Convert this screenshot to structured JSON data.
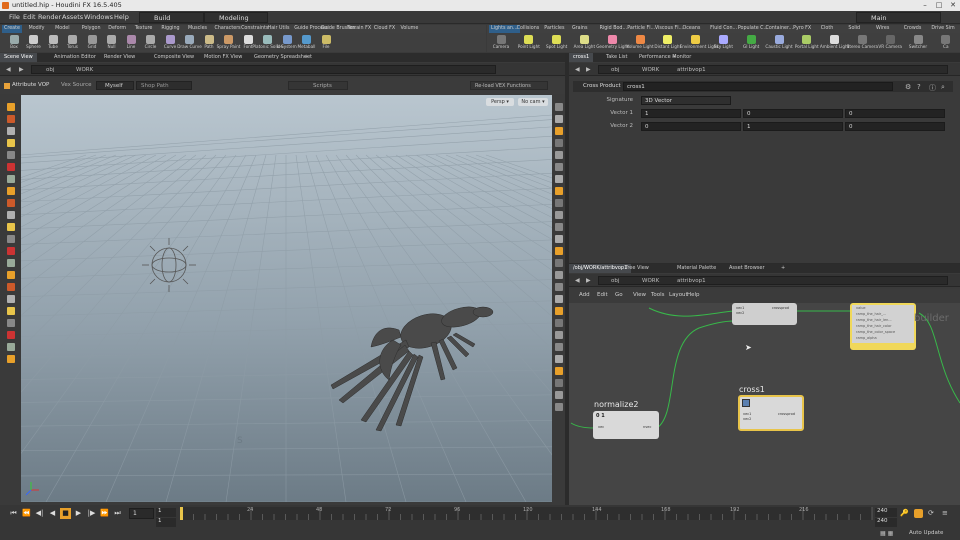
{
  "window": {
    "title": "untitled.hip - Houdini FX 16.5.405"
  },
  "menu": {
    "items": [
      "File",
      "Edit",
      "Render",
      "Assets",
      "Windows",
      "Help"
    ],
    "desktop": "Build",
    "context": "Modeling",
    "main_desktop": "Main"
  },
  "shelf_tabs_left": [
    "Create",
    "Modify",
    "Model",
    "Polygon",
    "Deform",
    "Texture",
    "Rigging",
    "Muscles",
    "Characters",
    "Constraints",
    "Hair Utils",
    "Guide Process",
    "Guide Brushes",
    "Terrain FX",
    "Cloud FX",
    "Volume"
  ],
  "shelf_tabs_right": [
    "Lights an...",
    "Collisions",
    "Particles",
    "Grains",
    "Rigid Bod...",
    "Particle Fl...",
    "Viscous Fl...",
    "Oceans",
    "Fluid Con...",
    "Populate C...",
    "Container...",
    "Pyro FX",
    "Cloth",
    "Solid",
    "Wires",
    "Crowds",
    "Drive Sim"
  ],
  "tools_left": [
    "Box",
    "Sphere",
    "Tube",
    "Torus",
    "Grid",
    "Null",
    "Line",
    "Circle",
    "Curve",
    "Draw Curve",
    "Path",
    "Spray Paint",
    "Font",
    "Platonic Solids",
    "L-System",
    "Metaball",
    "File"
  ],
  "tools_right": [
    "Camera",
    "Point Light",
    "Spot Light",
    "Area Light",
    "Geometry Light",
    "Volume Light",
    "Distant Light",
    "Environment Light",
    "Sky Light",
    "GI Light",
    "Caustic Light",
    "Portal Light",
    "Ambient Light",
    "Stereo Camera",
    "VR Camera",
    "Switcher",
    "Ca"
  ],
  "left_tabs": [
    "Scene View",
    "Animation Editor",
    "Render View",
    "Composite View",
    "Motion FX View",
    "Geometry Spreadsheet"
  ],
  "left_path": {
    "obj": "obj",
    "node": "WORK"
  },
  "viewer_bar": {
    "title": "Attribute VOP",
    "source_label": "Vex Source",
    "myself": "Myself",
    "shop_path": "Shop Path",
    "scripts": "Scripts",
    "reload": "Re-load VEX Functions"
  },
  "viewport": {
    "persp": "Persp ▾",
    "cam": "No cam ▾",
    "axis_label": "S"
  },
  "param_tabs": [
    "cross1",
    "Take List",
    "Performance Monitor"
  ],
  "param_path": {
    "obj": "obj",
    "work": "WORK",
    "vop": "attribvop1"
  },
  "param_header": {
    "type": "Cross Product",
    "name": "cross1"
  },
  "params": {
    "signature_label": "Signature",
    "signature_value": "3D Vector",
    "v1_label": "Vector 1",
    "v1": [
      "1",
      "0",
      "0"
    ],
    "v2_label": "Vector 2",
    "v2": [
      "0",
      "1",
      "0"
    ]
  },
  "net_tabs": [
    "/obj/WORK/attribvop1",
    "Tree View",
    "Material Palette",
    "Asset Browser"
  ],
  "net_path": {
    "obj": "obj",
    "work": "WORK",
    "vop": "attribvop1"
  },
  "net_menu": [
    "Add",
    "Edit",
    "Go",
    "View",
    "Tools",
    "Layout",
    "Help"
  ],
  "nodes": {
    "normalize2": {
      "title": "normalize2",
      "in": "vec",
      "out": "nvec"
    },
    "cross1": {
      "title": "cross1",
      "in1": "vec1",
      "in2": "vec2",
      "out": "crossprod"
    },
    "top": {
      "in1": "vec1",
      "in2": "vec2",
      "out": "crossprod"
    },
    "builder": {
      "label": "builder",
      "ports": [
        "value",
        "ramp_the_hair_...",
        "ramp_the_hair_len...",
        "ramp_the_hair_color",
        "ramp_the_color_space",
        "ramp_alpha"
      ]
    }
  },
  "timeline": {
    "frame": "1",
    "start": "1",
    "end1": "240",
    "end2": "240",
    "ticks": [
      "24",
      "48",
      "72",
      "96",
      "120",
      "144",
      "168",
      "192",
      "216"
    ],
    "auto_update": "Auto Update"
  },
  "colors": {
    "accent": "#e8c44a",
    "net_bg": "#454545",
    "node_body": "#d9d9d9"
  }
}
